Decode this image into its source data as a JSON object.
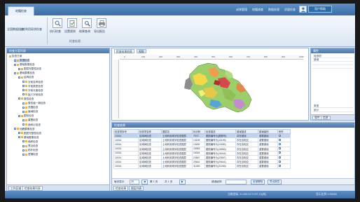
{
  "app": {
    "title_tab": "地籍检查",
    "top_links": [
      "成果管理",
      "地籍调查",
      "数据处理",
      "质量检查"
    ],
    "help_label": "用户帮助"
  },
  "ribbon": {
    "left_labels": [
      "全国数据检查",
      "土地利用现状检查"
    ],
    "buttons": [
      {
        "icon": "magnifier-icon",
        "label": "执行检查"
      },
      {
        "icon": "document-check-icon",
        "label": "设置规则"
      },
      {
        "icon": "search-icon",
        "label": "结果查询"
      },
      {
        "icon": "printer-icon",
        "label": "导出报告"
      }
    ],
    "group_title": "检查处理"
  },
  "left_panel": {
    "title": "检查方案列表",
    "root": "检查方案",
    "items": [
      {
        "label": "数据检查",
        "level": 1,
        "selected": true
      },
      {
        "label": "基础数据检查",
        "level": 1
      },
      {
        "label": "图层完整性检查",
        "level": 2
      },
      {
        "label": "基础要素检查",
        "level": 1
      },
      {
        "label": "结构检查",
        "level": 2
      },
      {
        "label": "字段名称检查",
        "level": 3
      },
      {
        "label": "字段类型检查",
        "level": 3
      },
      {
        "label": "字段长度检查",
        "level": 3
      },
      {
        "label": "缺少字段检查",
        "level": 3
      },
      {
        "label": "属性检查",
        "level": 2
      },
      {
        "label": "属性值一致检查",
        "level": 3
      },
      {
        "label": "范围检查",
        "level": 3
      },
      {
        "label": "值域检查",
        "level": 3
      },
      {
        "label": "图形检查",
        "level": 2
      },
      {
        "label": "重叠检查",
        "level": 3
      },
      {
        "label": "面碎片检查",
        "level": 3
      },
      {
        "label": "地籍要素检查",
        "level": 1
      },
      {
        "label": "图层完整性检查",
        "level": 2
      },
      {
        "label": "基础要素检查",
        "level": 2
      },
      {
        "label": "面积检查",
        "level": 3
      },
      {
        "label": "界址检查",
        "level": 3
      },
      {
        "label": "拓扑检查",
        "level": 3
      },
      {
        "label": "逻辑检查",
        "level": 3
      }
    ],
    "tabs": [
      "工作区域",
      "检查结果列表"
    ]
  },
  "map_panel": {
    "tabs": [
      "检查结果地图",
      "视图"
    ],
    "ruler_ticks": [
      "0",
      "100",
      "200",
      "300",
      "400",
      "500",
      "600",
      "700",
      "800",
      "900",
      "1000"
    ]
  },
  "right_panel": {
    "title": "属性",
    "rows": [
      {
        "key": "检查项",
        "value": ""
      },
      {
        "key": "错误",
        "value": ""
      },
      {
        "key": "",
        "value": ""
      },
      {
        "key": "",
        "value": ""
      },
      {
        "key": "类型",
        "value": ""
      },
      {
        "key": "统计",
        "value": ""
      }
    ],
    "tabs": [
      "属性",
      "信息"
    ]
  },
  "results": {
    "title": "检查结果",
    "columns": [
      "检查项序号",
      "检查项名称",
      "图层名",
      "标识码",
      "检查描述",
      "错误描述",
      "错误级别",
      "例外"
    ],
    "rows": [
      [
        "10014",
        "区域间检查",
        "土地利用现状检查图层",
        "7972",
        "图斑编号为(图斑号)",
        "存在错误",
        "重要错误",
        ""
      ],
      [
        "10014",
        "区域间检查",
        "土地利用现状检查图层",
        "13199",
        "图斑编号为(13199)",
        "存在自相交",
        "重要错误",
        ""
      ],
      [
        "10014",
        "区域间检查",
        "土地利用现状检查图层",
        "13282",
        "图斑编号为(13282)",
        "存在自相交",
        "重要错误",
        ""
      ],
      [
        "10014",
        "区域间检查",
        "土地利用现状检查图层",
        "15983",
        "图斑编号为(15983)",
        "存在自相交",
        "重要错误",
        ""
      ],
      [
        "10014",
        "区域间检查",
        "土地利用现状检查图层",
        "16044",
        "图斑编号为(16044)",
        "存在自相交",
        "重要错误",
        ""
      ],
      [
        "10014",
        "区域间检查",
        "土地利用现状检查图层",
        "23567",
        "图斑编号为(23567)",
        "存在自相交",
        "重要错误",
        ""
      ],
      [
        "10014",
        "区域间检查",
        "土地利用现状检查图层",
        "29642",
        "图斑编号为(29642)",
        "存在自相交",
        "重要错误",
        ""
      ],
      [
        "10014",
        "区域间检查",
        "土地利用现状检查图层",
        "31283",
        "图斑编号为(31283)",
        "存在自相交",
        "重要错误",
        ""
      ]
    ],
    "pager": {
      "prefix": "每页显示",
      "page_size": "20",
      "page_label": "第 1 页",
      "page_of": "共 1 页",
      "filter_label": "错误级别:",
      "buttons": [
        "全部删除",
        "导出报告"
      ]
    },
    "tabs": [
      "检查结果",
      "图层列表"
    ]
  },
  "status": {
    "left": "当前坐标: X=100.23  Y=57.15(米)",
    "right": "显示比例 1:28000"
  }
}
